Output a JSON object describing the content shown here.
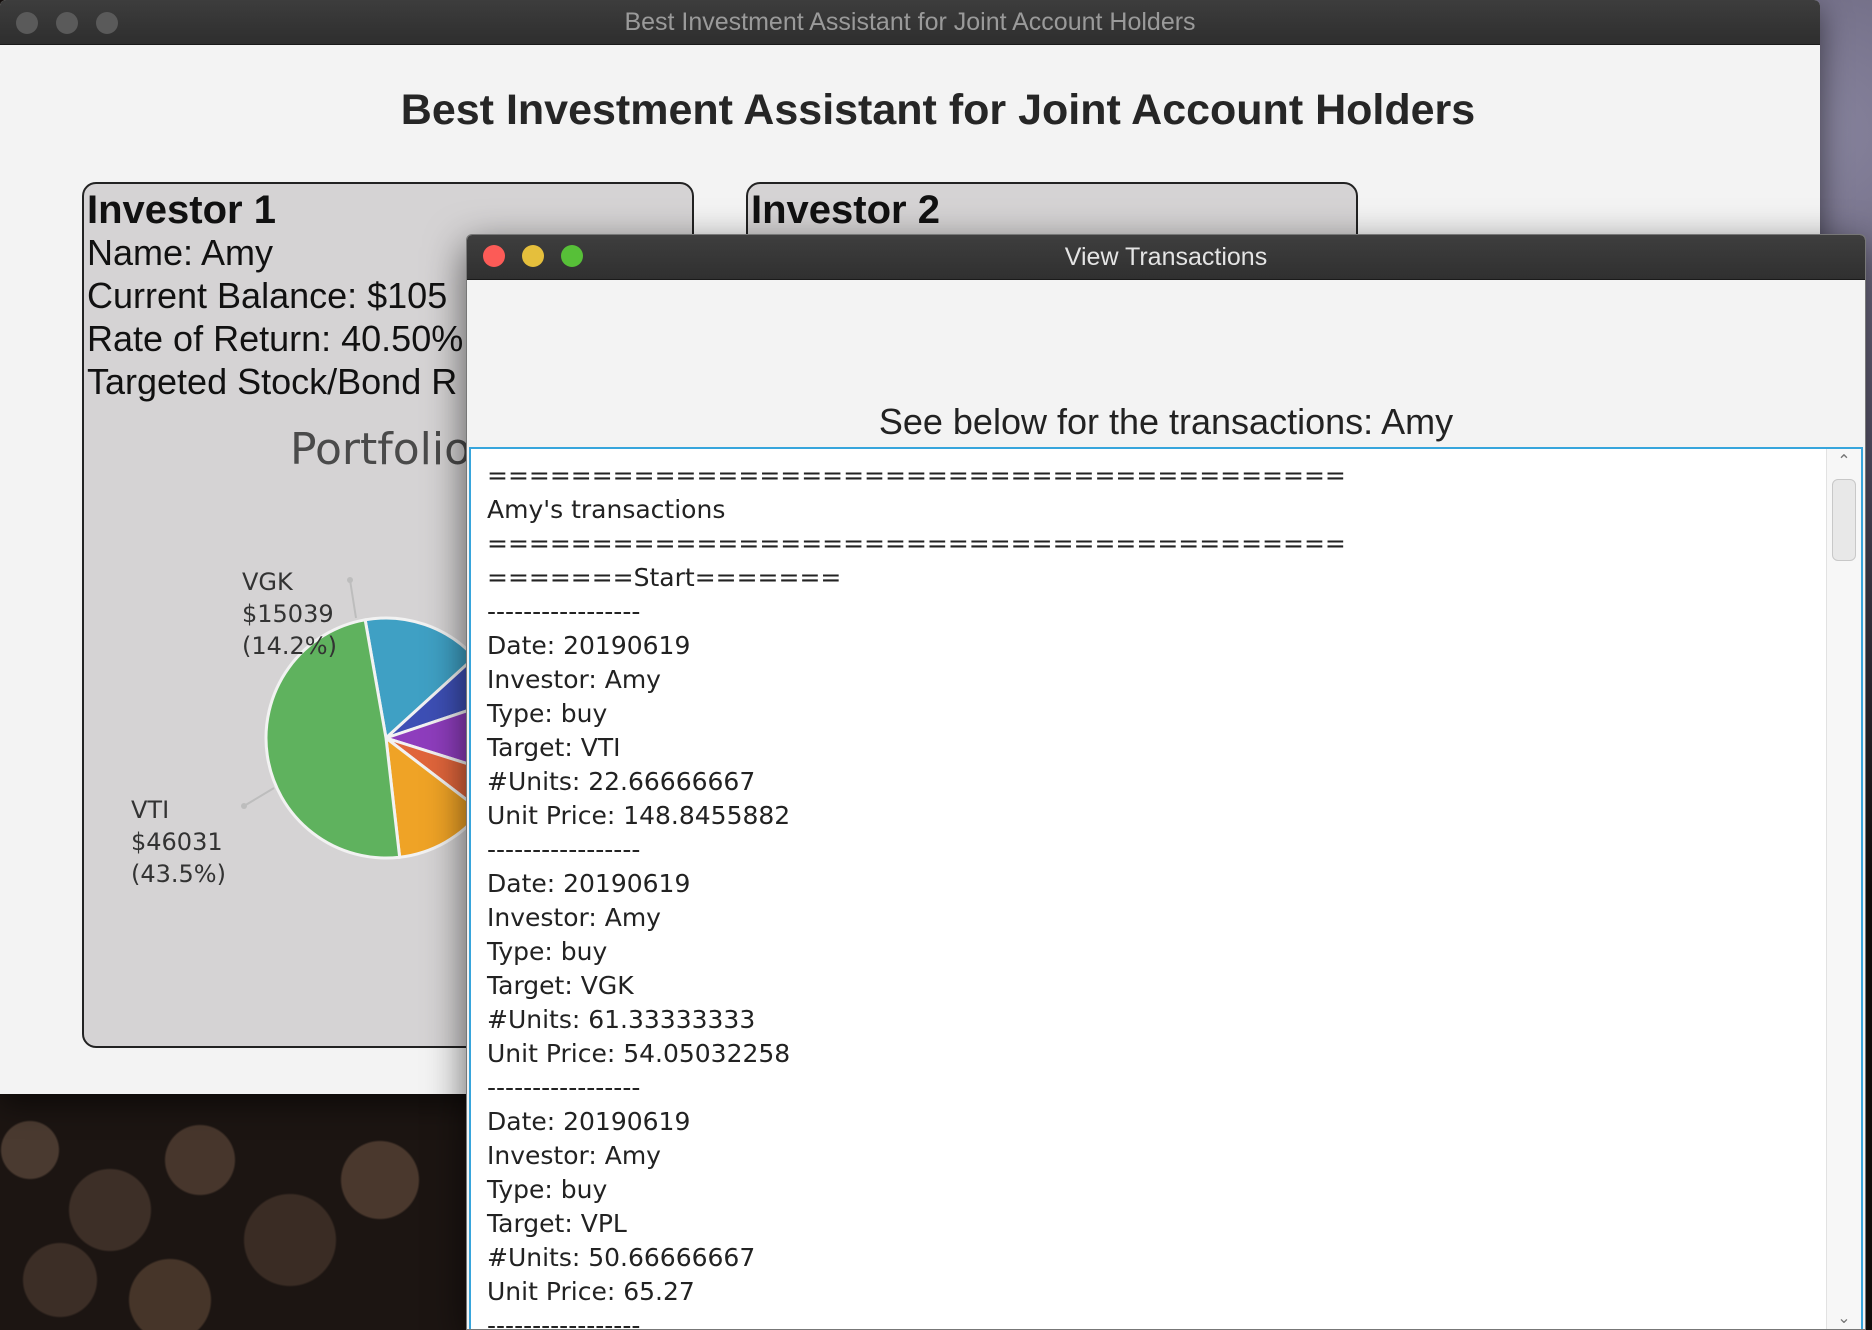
{
  "main_window": {
    "title": "Best Investment Assistant for Joint Account Holders",
    "heading": "Best Investment Assistant for Joint Account Holders"
  },
  "investor1": {
    "title": "Investor 1",
    "name_line": "Name: Amy",
    "balance_line": "Current Balance: $105",
    "return_line": "Rate of Return: 40.50%",
    "target_line": "Targeted Stock/Bond R",
    "chart_title": "Portfolio"
  },
  "investor2": {
    "title": "Investor 2"
  },
  "chart_data": {
    "type": "pie",
    "slices": [
      {
        "label": "VTI",
        "amount": "$46031",
        "percent": "(43.5%)",
        "value": 46031,
        "color": "#5fb25e"
      },
      {
        "label": "VGK",
        "amount": "$15039",
        "percent": "(14.2%)",
        "value": 15039,
        "color": "#3fa0c4"
      },
      {
        "value": 6200,
        "color": "#3d4fb5"
      },
      {
        "value": 9400,
        "color": "#8e3dbd"
      },
      {
        "value": 5200,
        "color": "#e0653b"
      },
      {
        "value": 12000,
        "color": "#efa326"
      }
    ]
  },
  "tx_window": {
    "title": "View Transactions",
    "heading": "See below for the transactions: Amy",
    "lines": [
      "=========================================",
      "Amy's transactions",
      "=========================================",
      "=======Start=======",
      "-----------------",
      "Date: 20190619",
      "Investor: Amy",
      "Type: buy",
      "Target: VTI",
      "#Units: 22.66666667",
      "Unit Price: 148.8455882",
      "-----------------",
      "Date: 20190619",
      "Investor: Amy",
      "Type: buy",
      "Target: VGK",
      "#Units: 61.33333333",
      "Unit Price: 54.05032258",
      "-----------------",
      "Date: 20190619",
      "Investor: Amy",
      "Type: buy",
      "Target: VPL",
      "#Units: 50.66666667",
      "Unit Price: 65.27",
      "-----------------"
    ]
  }
}
